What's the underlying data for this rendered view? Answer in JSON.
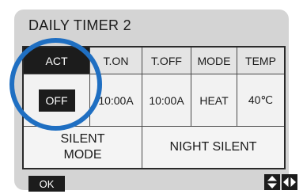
{
  "screen": {
    "title": "DAILY TIMER 2",
    "columns": [
      "ACT",
      "T.ON",
      "T.OFF",
      "MODE",
      "TEMP"
    ],
    "selected_column": "ACT",
    "values": {
      "act": "OFF",
      "t_on": "10:00A",
      "t_off": "10:00A",
      "mode": "HEAT",
      "temp": "40℃"
    },
    "bottom": {
      "silent_mode": "SILENT\nMODE",
      "night_silent": "NIGHT SILENT"
    },
    "ok_label": "OK",
    "nav_icons": [
      "up-down-arrows-icon",
      "left-right-arrows-icon"
    ]
  },
  "colors": {
    "panel": "#d4d4d4",
    "selected_bg": "#1c1c1c",
    "highlight_ring": "#1f6fc2"
  }
}
